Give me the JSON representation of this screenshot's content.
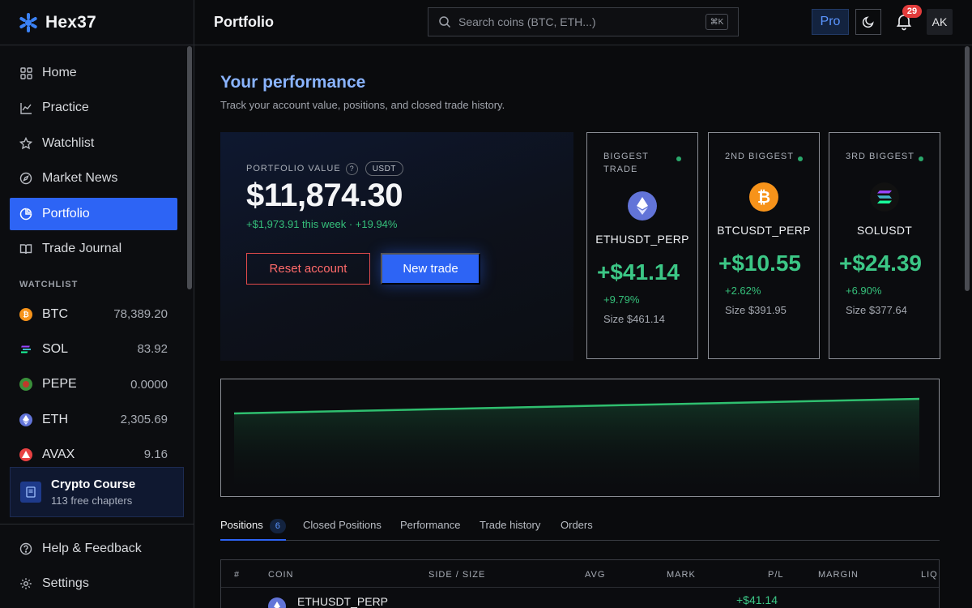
{
  "brand": {
    "name": "Hex37"
  },
  "nav": [
    {
      "label": "Home",
      "icon": "grid-icon"
    },
    {
      "label": "Practice",
      "icon": "chart-line-icon"
    },
    {
      "label": "Watchlist",
      "icon": "star-icon"
    },
    {
      "label": "Market News",
      "icon": "compass-icon"
    },
    {
      "label": "Portfolio",
      "icon": "pie-chart-icon",
      "active": true
    },
    {
      "label": "Trade Journal",
      "icon": "book-icon"
    }
  ],
  "watchlist": {
    "heading": "WATCHLIST",
    "items": [
      {
        "symbol": "BTC",
        "price": "78,389.20",
        "color": "#f7931a"
      },
      {
        "symbol": "SOL",
        "price": "83.92",
        "color": "#1b1b2e"
      },
      {
        "symbol": "PEPE",
        "price": "0.0000",
        "color": "#3a8f3a"
      },
      {
        "symbol": "ETH",
        "price": "2,305.69",
        "color": "#6274d8"
      },
      {
        "symbol": "AVAX",
        "price": "9.16",
        "color": "#e84142"
      }
    ]
  },
  "course": {
    "title": "Crypto Course",
    "subtitle": "113 free chapters"
  },
  "footer_nav": [
    {
      "label": "Help & Feedback",
      "icon": "help-circle-icon"
    },
    {
      "label": "Settings",
      "icon": "gear-icon"
    }
  ],
  "topbar": {
    "title": "Portfolio",
    "search_placeholder": "Search coins (BTC, ETH...)",
    "search_shortcut": "⌘K",
    "pro_label": "Pro",
    "notification_count": "29",
    "avatar_initials": "AK"
  },
  "header": {
    "title": "Your performance",
    "subtitle": "Track your account value, positions, and closed trade history."
  },
  "portfolio": {
    "label": "PORTFOLIO VALUE",
    "currency": "USDT",
    "value": "$11,874.30",
    "change": "+$1,973.91 this week · +19.94%",
    "reset_label": "Reset account",
    "new_trade_label": "New trade"
  },
  "trades": [
    {
      "label": "BIGGEST TRADE",
      "symbol": "ETHUSDT_PERP",
      "pl": "+$41.14",
      "pct": "+9.79%",
      "size": "Size $461.14",
      "coin": "eth"
    },
    {
      "label": "2ND BIGGEST",
      "symbol": "BTCUSDT_PERP",
      "pl": "+$10.55",
      "pct": "+2.62%",
      "size": "Size $391.95",
      "coin": "btc"
    },
    {
      "label": "3RD BIGGEST",
      "symbol": "SOLUSDT",
      "pl": "+$24.39",
      "pct": "+6.90%",
      "size": "Size $377.64",
      "coin": "sol"
    }
  ],
  "equity_curve": {
    "trend": [
      0,
      1
    ],
    "color": "#2fbf6f"
  },
  "tabs": [
    {
      "label": "Positions",
      "count": "6",
      "active": true
    },
    {
      "label": "Closed Positions"
    },
    {
      "label": "Performance"
    },
    {
      "label": "Trade history"
    },
    {
      "label": "Orders"
    }
  ],
  "table": {
    "headers": [
      "#",
      "COIN",
      "SIDE / SIZE",
      "AVG",
      "MARK",
      "P/L",
      "MARGIN",
      "LIQ"
    ],
    "first_row": {
      "coin": "ETHUSDT_PERP",
      "pl": "+$41.14"
    }
  },
  "colors": {
    "accent": "#2d64f5",
    "positive": "#35c07b",
    "negative": "#e24b4b",
    "title_blue": "#8ab4ff"
  }
}
